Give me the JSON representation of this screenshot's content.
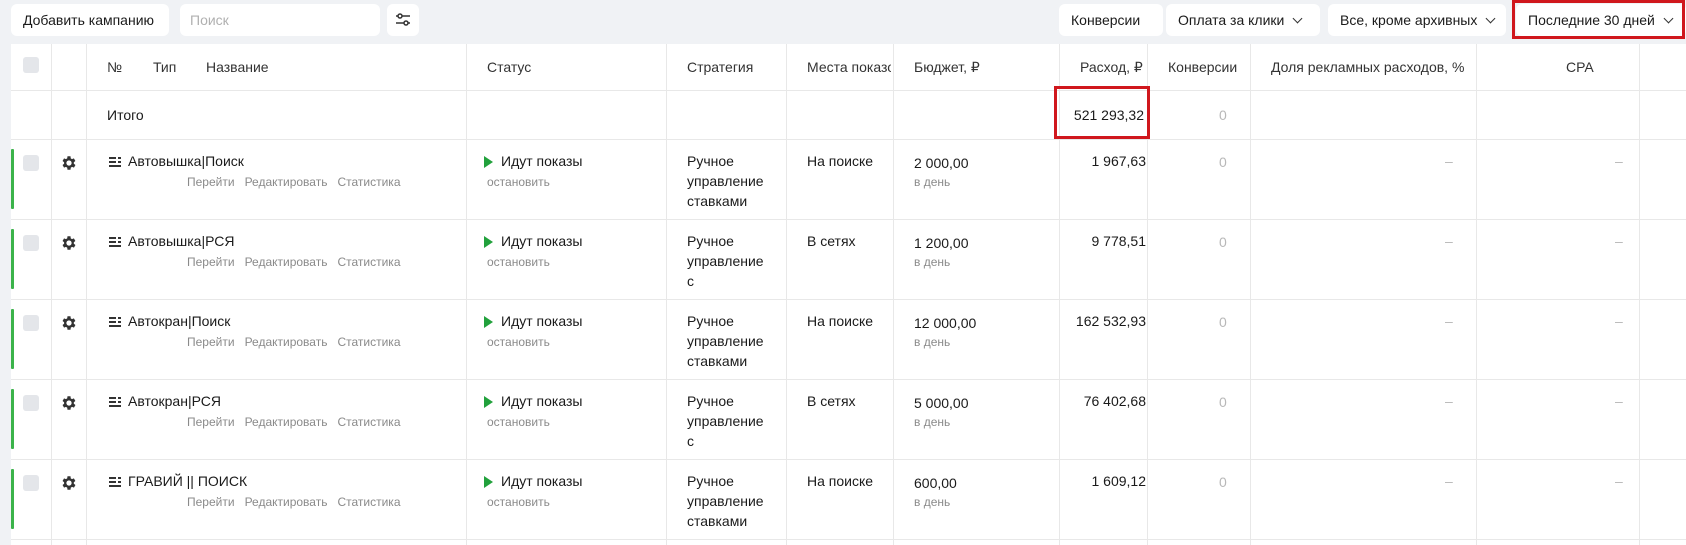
{
  "toolbar": {
    "add_campaign": "Добавить кампанию",
    "search_placeholder": "Поиск",
    "conversions": "Конверсии",
    "payment": "Оплата за клики",
    "archive_filter": "Все, кроме архивных",
    "period": "Последние 30 дней"
  },
  "columns": {
    "number": "№",
    "type": "Тип",
    "name": "Название",
    "status": "Статус",
    "strategy": "Стратегия",
    "placement": "Места показов",
    "budget": "Бюджет, ₽",
    "spend": "Расход, ₽",
    "conversions": "Конверсии",
    "ad_share": "Доля рекламных расходов, %",
    "cpa": "CPA"
  },
  "total": {
    "label": "Итого",
    "spend": "521 293,32",
    "conversions": "0"
  },
  "row_links": {
    "go": "Перейти",
    "edit": "Редактировать",
    "stats": "Статистика"
  },
  "rows": [
    {
      "name": "Автовышка|Поиск",
      "status": "Идут показы",
      "status_action": "остановить",
      "strategy_1": "Ручное",
      "strategy_2": "управление",
      "strategy_3": "ставками",
      "placement": "На поиске",
      "budget": "2 000,00",
      "budget_period": "в день",
      "spend": "1 967,63",
      "conversions": "0",
      "ad_share": "–",
      "cpa": "–"
    },
    {
      "name": "Автовышка|РСЯ",
      "status": "Идут показы",
      "status_action": "остановить",
      "strategy_1": "Ручное",
      "strategy_2": "управление",
      "strategy_3": "с",
      "placement": "В сетях",
      "budget": "1 200,00",
      "budget_period": "в день",
      "spend": "9 778,51",
      "conversions": "0",
      "ad_share": "–",
      "cpa": "–"
    },
    {
      "name": "Автокран|Поиск",
      "status": "Идут показы",
      "status_action": "остановить",
      "strategy_1": "Ручное",
      "strategy_2": "управление",
      "strategy_3": "ставками",
      "placement": "На поиске",
      "budget": "12 000,00",
      "budget_period": "в день",
      "spend": "162 532,93",
      "conversions": "0",
      "ad_share": "–",
      "cpa": "–"
    },
    {
      "name": "Автокран|РСЯ",
      "status": "Идут показы",
      "status_action": "остановить",
      "strategy_1": "Ручное",
      "strategy_2": "управление",
      "strategy_3": "с",
      "placement": "В сетях",
      "budget": "5 000,00",
      "budget_period": "в день",
      "spend": "76 402,68",
      "conversions": "0",
      "ad_share": "–",
      "cpa": "–"
    },
    {
      "name": "ГРАВИЙ || ПОИСК",
      "status": "Идут показы",
      "status_action": "остановить",
      "strategy_1": "Ручное",
      "strategy_2": "управление",
      "strategy_3": "ставками",
      "placement": "На поиске",
      "budget": "600,00",
      "budget_period": "в день",
      "spend": "1 609,12",
      "conversions": "0",
      "ad_share": "–",
      "cpa": "–"
    }
  ],
  "colors": {
    "status_play": "#22a13c",
    "active_bar": "#3bb34a",
    "highlight": "#d0171d"
  },
  "icons": {
    "settings": "gear-icon",
    "campaign_type": "text-campaign-icon",
    "filter": "filter-settings-icon",
    "dropdown": "chevron-down-icon",
    "status": "play-icon"
  }
}
